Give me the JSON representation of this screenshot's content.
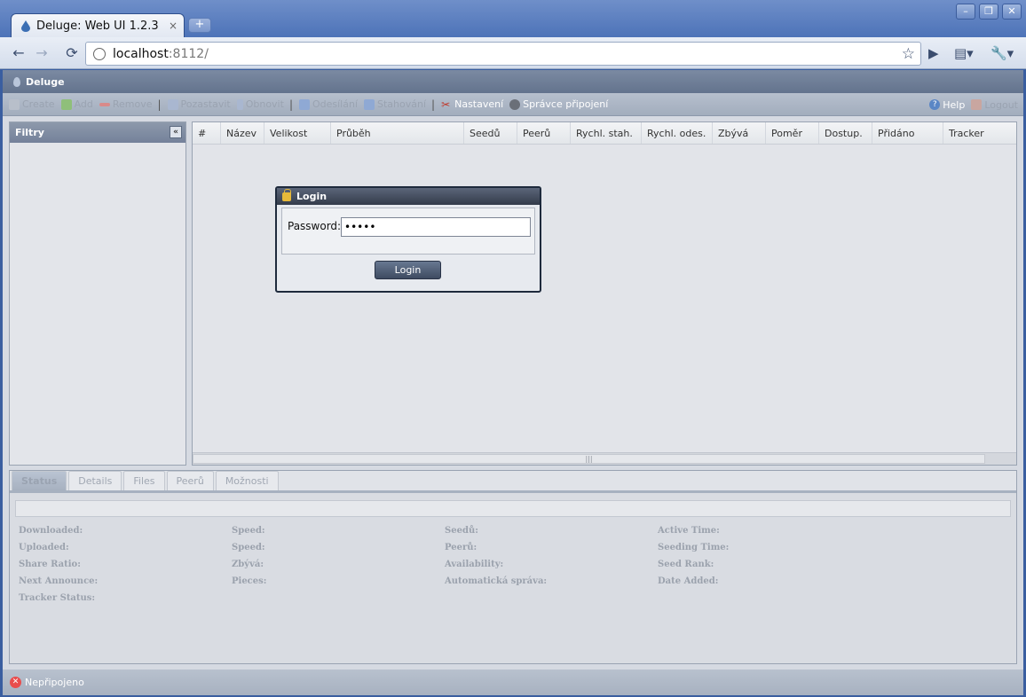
{
  "browser": {
    "tab_title": "Deluge: Web UI 1.2.3",
    "tab_close": "×",
    "new_tab": "+",
    "window_controls": [
      "–",
      "❐",
      "✕"
    ],
    "url_host": "localhost",
    "url_rest": ":8112/"
  },
  "app": {
    "title": "Deluge",
    "toolbar_left": [
      {
        "label": "Create",
        "enabled": false,
        "icon": "create-icon"
      },
      {
        "label": "Add",
        "enabled": false,
        "icon": "add-icon"
      },
      {
        "label": "Remove",
        "enabled": false,
        "icon": "remove-icon"
      },
      {
        "label": "Pozastavit",
        "enabled": false,
        "icon": "pause-icon"
      },
      {
        "label": "Obnovit",
        "enabled": false,
        "icon": "resume-icon"
      },
      {
        "label": "Odesílání",
        "enabled": false,
        "icon": "up-icon"
      },
      {
        "label": "Stahování",
        "enabled": false,
        "icon": "down-icon"
      },
      {
        "label": "Nastavení",
        "enabled": true,
        "icon": "preferences-icon"
      },
      {
        "label": "Správce připojení",
        "enabled": true,
        "icon": "connection-manager-icon"
      }
    ],
    "toolbar_right": [
      {
        "label": "Help",
        "enabled": true
      },
      {
        "label": "Logout",
        "enabled": false
      }
    ],
    "filters_title": "Filtry",
    "columns": [
      "#",
      "Název",
      "Velikost",
      "Průběh",
      "Seedů",
      "Peerů",
      "Rychl. stah.",
      "Rychl. odes.",
      "Zbývá",
      "Poměr",
      "Dostup.",
      "Přidáno",
      "Tracker"
    ],
    "detail_tabs": [
      "Status",
      "Details",
      "Files",
      "Peerů",
      "Možnosti"
    ],
    "stats": {
      "col1": [
        "Downloaded:",
        "Uploaded:",
        "Share Ratio:",
        "Next Announce:",
        "Tracker Status:"
      ],
      "col2": [
        "Speed:",
        "Speed:",
        "Zbývá:",
        "Pieces:"
      ],
      "col3": [
        "Seedů:",
        "Peerů:",
        "Availability:",
        "Automatická správa:"
      ],
      "col4": [
        "Active Time:",
        "Seeding Time:",
        "Seed Rank:",
        "Date Added:"
      ]
    },
    "status": "Nepřipojeno"
  },
  "login": {
    "title": "Login",
    "password_label": "Password:",
    "password_value": "•••••",
    "button": "Login"
  }
}
